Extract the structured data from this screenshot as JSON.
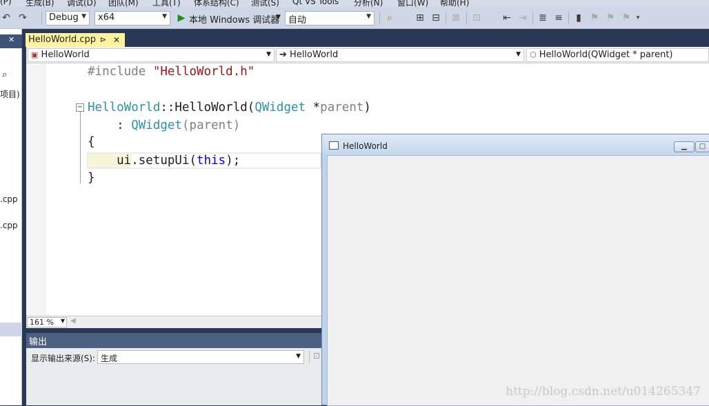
{
  "menu": [
    "(P)",
    "生成(B)",
    "调试(D)",
    "团队(M)",
    "工具(T)",
    "体系结构(C)",
    "测试(S)",
    "Qt VS Tools",
    "分析(N)",
    "窗口(W)",
    "帮助(H)"
  ],
  "toolbar": {
    "config": "Debug",
    "platform": "x64",
    "debugger": "本地 Windows 调试器",
    "mode": "自动"
  },
  "left_panel": {
    "item1": "项目)",
    "item2": ".cpp",
    "item3": ".cpp"
  },
  "tab": {
    "label": "HelloWorld.cpp",
    "pin": "⊳",
    "close": "✕"
  },
  "nav": {
    "scope": "HelloWorld",
    "class": "HelloWorld",
    "member": "HelloWorld(QWidget * parent)"
  },
  "code": {
    "l1a": "#include ",
    "l1b": "\"HelloWorld.h\"",
    "l2a": "HelloWorld",
    "l2b": "::HelloWorld(",
    "l2c": "QWidget",
    "l2d": " *",
    "l2e": "parent",
    ")": ")",
    "l3a": "    : ",
    "l3b": "QWidget",
    "l3c": "(",
    "l3d": "parent",
    "l3e": ")",
    "l4": "{",
    "l5a": "    ui",
    "l5b": ".setupUi(",
    "l5c": "this",
    "l5d": ");",
    "l6": "}"
  },
  "status": {
    "zoom": "161 %"
  },
  "output": {
    "title": "输出",
    "source_label": "显示输出来源(S):",
    "source_value": "生成"
  },
  "qt_window": {
    "title": "HelloWorld"
  },
  "watermark": "http://blog.csdn.net/u014265347"
}
